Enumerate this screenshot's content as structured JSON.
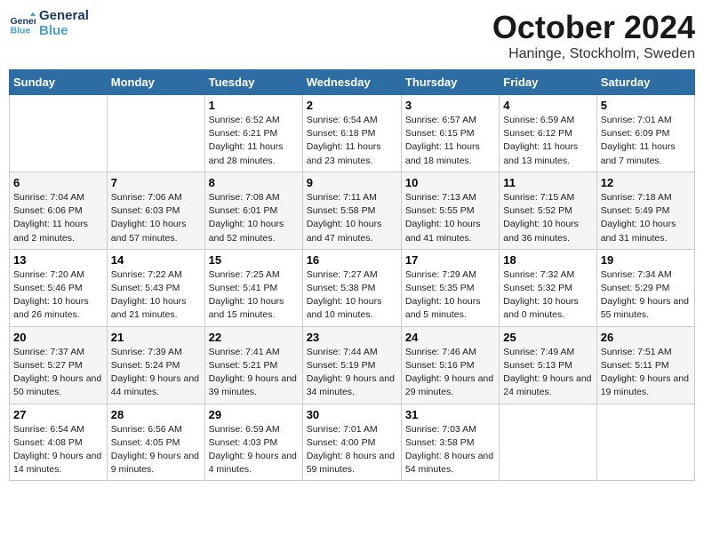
{
  "header": {
    "logo_general": "General",
    "logo_blue": "Blue",
    "month": "October 2024",
    "location": "Haninge, Stockholm, Sweden"
  },
  "weekdays": [
    "Sunday",
    "Monday",
    "Tuesday",
    "Wednesday",
    "Thursday",
    "Friday",
    "Saturday"
  ],
  "weeks": [
    [
      {
        "day": "",
        "sunrise": "",
        "sunset": "",
        "daylight": ""
      },
      {
        "day": "",
        "sunrise": "",
        "sunset": "",
        "daylight": ""
      },
      {
        "day": "1",
        "sunrise": "Sunrise: 6:52 AM",
        "sunset": "Sunset: 6:21 PM",
        "daylight": "Daylight: 11 hours and 28 minutes."
      },
      {
        "day": "2",
        "sunrise": "Sunrise: 6:54 AM",
        "sunset": "Sunset: 6:18 PM",
        "daylight": "Daylight: 11 hours and 23 minutes."
      },
      {
        "day": "3",
        "sunrise": "Sunrise: 6:57 AM",
        "sunset": "Sunset: 6:15 PM",
        "daylight": "Daylight: 11 hours and 18 minutes."
      },
      {
        "day": "4",
        "sunrise": "Sunrise: 6:59 AM",
        "sunset": "Sunset: 6:12 PM",
        "daylight": "Daylight: 11 hours and 13 minutes."
      },
      {
        "day": "5",
        "sunrise": "Sunrise: 7:01 AM",
        "sunset": "Sunset: 6:09 PM",
        "daylight": "Daylight: 11 hours and 7 minutes."
      }
    ],
    [
      {
        "day": "6",
        "sunrise": "Sunrise: 7:04 AM",
        "sunset": "Sunset: 6:06 PM",
        "daylight": "Daylight: 11 hours and 2 minutes."
      },
      {
        "day": "7",
        "sunrise": "Sunrise: 7:06 AM",
        "sunset": "Sunset: 6:03 PM",
        "daylight": "Daylight: 10 hours and 57 minutes."
      },
      {
        "day": "8",
        "sunrise": "Sunrise: 7:08 AM",
        "sunset": "Sunset: 6:01 PM",
        "daylight": "Daylight: 10 hours and 52 minutes."
      },
      {
        "day": "9",
        "sunrise": "Sunrise: 7:11 AM",
        "sunset": "Sunset: 5:58 PM",
        "daylight": "Daylight: 10 hours and 47 minutes."
      },
      {
        "day": "10",
        "sunrise": "Sunrise: 7:13 AM",
        "sunset": "Sunset: 5:55 PM",
        "daylight": "Daylight: 10 hours and 41 minutes."
      },
      {
        "day": "11",
        "sunrise": "Sunrise: 7:15 AM",
        "sunset": "Sunset: 5:52 PM",
        "daylight": "Daylight: 10 hours and 36 minutes."
      },
      {
        "day": "12",
        "sunrise": "Sunrise: 7:18 AM",
        "sunset": "Sunset: 5:49 PM",
        "daylight": "Daylight: 10 hours and 31 minutes."
      }
    ],
    [
      {
        "day": "13",
        "sunrise": "Sunrise: 7:20 AM",
        "sunset": "Sunset: 5:46 PM",
        "daylight": "Daylight: 10 hours and 26 minutes."
      },
      {
        "day": "14",
        "sunrise": "Sunrise: 7:22 AM",
        "sunset": "Sunset: 5:43 PM",
        "daylight": "Daylight: 10 hours and 21 minutes."
      },
      {
        "day": "15",
        "sunrise": "Sunrise: 7:25 AM",
        "sunset": "Sunset: 5:41 PM",
        "daylight": "Daylight: 10 hours and 15 minutes."
      },
      {
        "day": "16",
        "sunrise": "Sunrise: 7:27 AM",
        "sunset": "Sunset: 5:38 PM",
        "daylight": "Daylight: 10 hours and 10 minutes."
      },
      {
        "day": "17",
        "sunrise": "Sunrise: 7:29 AM",
        "sunset": "Sunset: 5:35 PM",
        "daylight": "Daylight: 10 hours and 5 minutes."
      },
      {
        "day": "18",
        "sunrise": "Sunrise: 7:32 AM",
        "sunset": "Sunset: 5:32 PM",
        "daylight": "Daylight: 10 hours and 0 minutes."
      },
      {
        "day": "19",
        "sunrise": "Sunrise: 7:34 AM",
        "sunset": "Sunset: 5:29 PM",
        "daylight": "Daylight: 9 hours and 55 minutes."
      }
    ],
    [
      {
        "day": "20",
        "sunrise": "Sunrise: 7:37 AM",
        "sunset": "Sunset: 5:27 PM",
        "daylight": "Daylight: 9 hours and 50 minutes."
      },
      {
        "day": "21",
        "sunrise": "Sunrise: 7:39 AM",
        "sunset": "Sunset: 5:24 PM",
        "daylight": "Daylight: 9 hours and 44 minutes."
      },
      {
        "day": "22",
        "sunrise": "Sunrise: 7:41 AM",
        "sunset": "Sunset: 5:21 PM",
        "daylight": "Daylight: 9 hours and 39 minutes."
      },
      {
        "day": "23",
        "sunrise": "Sunrise: 7:44 AM",
        "sunset": "Sunset: 5:19 PM",
        "daylight": "Daylight: 9 hours and 34 minutes."
      },
      {
        "day": "24",
        "sunrise": "Sunrise: 7:46 AM",
        "sunset": "Sunset: 5:16 PM",
        "daylight": "Daylight: 9 hours and 29 minutes."
      },
      {
        "day": "25",
        "sunrise": "Sunrise: 7:49 AM",
        "sunset": "Sunset: 5:13 PM",
        "daylight": "Daylight: 9 hours and 24 minutes."
      },
      {
        "day": "26",
        "sunrise": "Sunrise: 7:51 AM",
        "sunset": "Sunset: 5:11 PM",
        "daylight": "Daylight: 9 hours and 19 minutes."
      }
    ],
    [
      {
        "day": "27",
        "sunrise": "Sunrise: 6:54 AM",
        "sunset": "Sunset: 4:08 PM",
        "daylight": "Daylight: 9 hours and 14 minutes."
      },
      {
        "day": "28",
        "sunrise": "Sunrise: 6:56 AM",
        "sunset": "Sunset: 4:05 PM",
        "daylight": "Daylight: 9 hours and 9 minutes."
      },
      {
        "day": "29",
        "sunrise": "Sunrise: 6:59 AM",
        "sunset": "Sunset: 4:03 PM",
        "daylight": "Daylight: 9 hours and 4 minutes."
      },
      {
        "day": "30",
        "sunrise": "Sunrise: 7:01 AM",
        "sunset": "Sunset: 4:00 PM",
        "daylight": "Daylight: 8 hours and 59 minutes."
      },
      {
        "day": "31",
        "sunrise": "Sunrise: 7:03 AM",
        "sunset": "Sunset: 3:58 PM",
        "daylight": "Daylight: 8 hours and 54 minutes."
      },
      {
        "day": "",
        "sunrise": "",
        "sunset": "",
        "daylight": ""
      },
      {
        "day": "",
        "sunrise": "",
        "sunset": "",
        "daylight": ""
      }
    ]
  ]
}
